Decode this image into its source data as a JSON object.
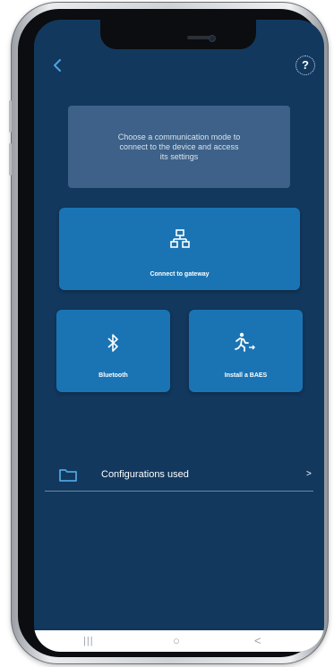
{
  "header": {
    "back_icon": "chevron-left-icon",
    "help_icon": "help-icon",
    "help_symbol": "?"
  },
  "info": {
    "line1": "Choose a communication mode to",
    "line2": "connect to the device and access",
    "line3": "its settings"
  },
  "modes": {
    "gateway": {
      "label": "Connect to gateway",
      "icon": "network-hierarchy-icon"
    },
    "bluetooth": {
      "label": "Bluetooth",
      "icon": "bluetooth-icon"
    },
    "baes": {
      "label": "Install a BAES",
      "icon": "running-person-exit-icon"
    }
  },
  "configurations": {
    "label": "Configurations used",
    "arrow": ">",
    "icon": "folder-icon"
  },
  "nav": {
    "recent": "|||",
    "home": "○",
    "back": "<"
  },
  "colors": {
    "screen_bg": "#12385e",
    "info_box": "#3d6188",
    "card": "#1a74b4",
    "text": "#ffffff"
  }
}
